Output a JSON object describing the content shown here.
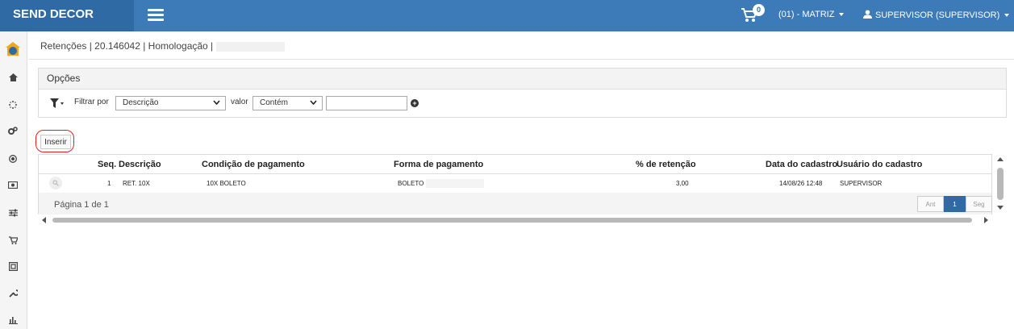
{
  "header": {
    "brand": "SEND DECOR",
    "cart_count": "0",
    "branch": "(01) - MATRIZ",
    "user": "SUPERVISOR (SUPERVISOR)"
  },
  "colors": {
    "topbar": "#3c7ab8",
    "brand_bg": "#2f6aa5",
    "highlight_ring": "#e02020"
  },
  "sidebar": {
    "icons": [
      "logo-icon",
      "home-icon",
      "spinner-icon",
      "gears-icon",
      "target-icon",
      "money-icon",
      "sliders-icon",
      "cart-icon",
      "image-icon",
      "wrench-icon",
      "bar-chart-icon"
    ]
  },
  "breadcrumb": "Retenções | 20.146042 | Homologação |",
  "options": {
    "title": "Opções",
    "filter_label": "Filtrar por",
    "filter_field": "Descrição",
    "value_label": "valor",
    "operator": "Contém",
    "value_input": ""
  },
  "actions": {
    "insert_label": "Inserir"
  },
  "table": {
    "columns": [
      "Seq.",
      "Descrição",
      "Condição de pagamento",
      "Forma de pagamento",
      "% de retenção",
      "Data do cadastro",
      "Usuário do cadastro"
    ],
    "rows": [
      {
        "seq": "1",
        "descricao": "RET. 10X",
        "condicao": "10X BOLETO",
        "forma": "BOLETO",
        "retencao": "3,00",
        "data": "14/08/26 12:48",
        "usuario": "SUPERVISOR"
      }
    ]
  },
  "pagination": {
    "label": "Página 1 de 1",
    "prev": "Ant",
    "current": "1",
    "next": "Seg"
  }
}
